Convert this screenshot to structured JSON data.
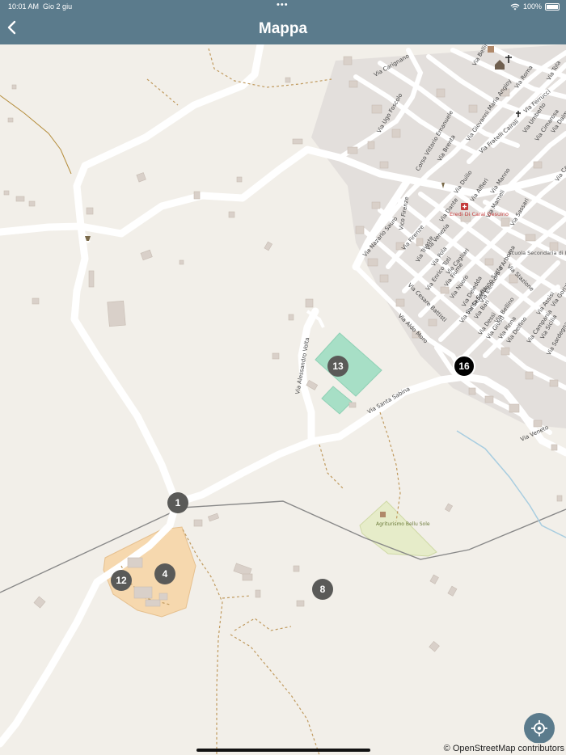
{
  "status_bar": {
    "time": "10:01 AM",
    "date": "Gio 2 giu",
    "battery": "100%",
    "wifi_icon": "wifi-icon",
    "battery_icon": "battery-icon"
  },
  "header": {
    "title": "Mappa",
    "back_icon": "chevron-left-icon"
  },
  "map": {
    "attribution": "© OpenStreetMap contributors",
    "markers": [
      {
        "label": "1",
        "style": "grey"
      },
      {
        "label": "4",
        "style": "grey"
      },
      {
        "label": "8",
        "style": "grey"
      },
      {
        "label": "12",
        "style": "grey"
      },
      {
        "label": "13",
        "style": "grey"
      },
      {
        "label": "16",
        "style": "black"
      }
    ],
    "street_labels": [
      "Via Santa Sabina",
      "Via Alessandro Volta",
      "Via Aldo Moro",
      "Via Veneto",
      "Via Cesare Battisti",
      "Corso Vittorio Emanuele",
      "Via Trieste",
      "Via Brenta",
      "Via Bellini",
      "Via Nazario Sauro",
      "Via Eleonora d'Arborea",
      "Via Stazione",
      "Via Deledda",
      "Via Sassari",
      "Via Sardegna",
      "Via Mameli",
      "Via Sicilia",
      "Via Carignano",
      "Via Ugo Foscolo",
      "Via Giovanni Maria Angioy",
      "Via Roma",
      "Via Umberto",
      "Via Tola",
      "Via Ferrucci",
      "Via Fratelli Cairoli",
      "Vico Firenze",
      "Via Firenze",
      "Via Venezia",
      "Via Cagliari",
      "Via Bellino",
      "Via Campania",
      "Via Assisi",
      "Via Gorizia",
      "Via Bari",
      "Via Dante",
      "Via Pola",
      "Via Fiume",
      "Via Enrico Toti",
      "Via Nuoro",
      "Via Santa Sofia",
      "Via Sebastiano Satta",
      "Via Giusti",
      "Via Duilio",
      "Via Alfieri",
      "Via Delfino",
      "Via Pinna",
      "Via Dessì",
      "Via Manno",
      "Via Dalmazia",
      "Via Carlo Alberto",
      "Via Cimarosa"
    ],
    "poi_labels": {
      "pharmacy": "Eredi Di Carai Gesuino",
      "school": "Scuola Secondaria di I grado",
      "agriturismo": "Agriturismo Bellu Sole"
    },
    "icons": [
      "location-target-icon",
      "church-icon",
      "cross-icon",
      "fountain-icon",
      "pharmacy-icon"
    ]
  }
}
